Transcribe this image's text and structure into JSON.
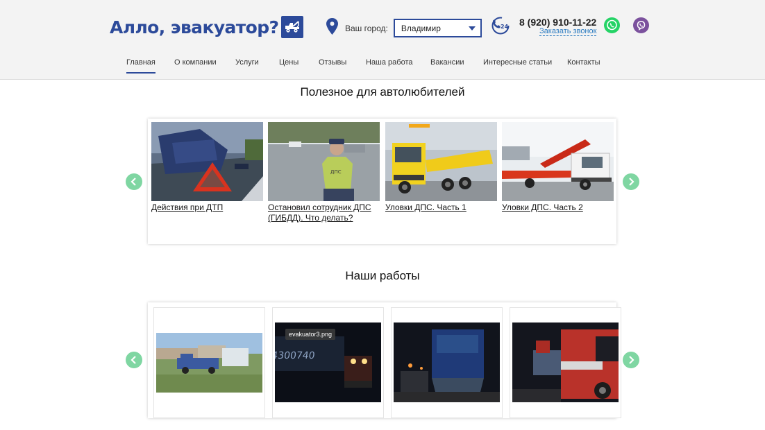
{
  "header": {
    "logo_text": "Алло, эвакуатор?",
    "city_label": "Ваш город:",
    "city_value": "Владимир",
    "phone": "8 (920) 910-11-22",
    "callback": "Заказать звонок",
    "icons": [
      "location-pin-icon",
      "phone-24-icon",
      "whatsapp-icon",
      "viber-icon"
    ]
  },
  "nav": {
    "items": [
      {
        "label": "Главная",
        "active": true
      },
      {
        "label": "О компании"
      },
      {
        "label": "Услуги"
      },
      {
        "label": "Цены"
      },
      {
        "label": "Отзывы"
      },
      {
        "label": "Наша работа"
      },
      {
        "label": "Вакансии"
      },
      {
        "label": "Интересные статьи"
      },
      {
        "label": "Контакты"
      }
    ]
  },
  "articles": {
    "title": "Полезное для автолюбителей",
    "items": [
      {
        "title": "Действия при ДТП"
      },
      {
        "title": "Остановил сотрудник ДПС (ГИБДД). Что делать?",
        "badge": "ДПС"
      },
      {
        "title": "Уловки ДПС. Часть 1"
      },
      {
        "title": "Уловки ДПС. Часть 2"
      }
    ]
  },
  "works": {
    "title": "Наши работы",
    "tooltip": "evakuator3.png",
    "plate_text": "4300740"
  },
  "colors": {
    "brand": "#2c4a9a",
    "arrow": "#7fd6a2",
    "link": "#2c7bc0",
    "whatsapp": "#25d366",
    "viber": "#7b519d"
  }
}
